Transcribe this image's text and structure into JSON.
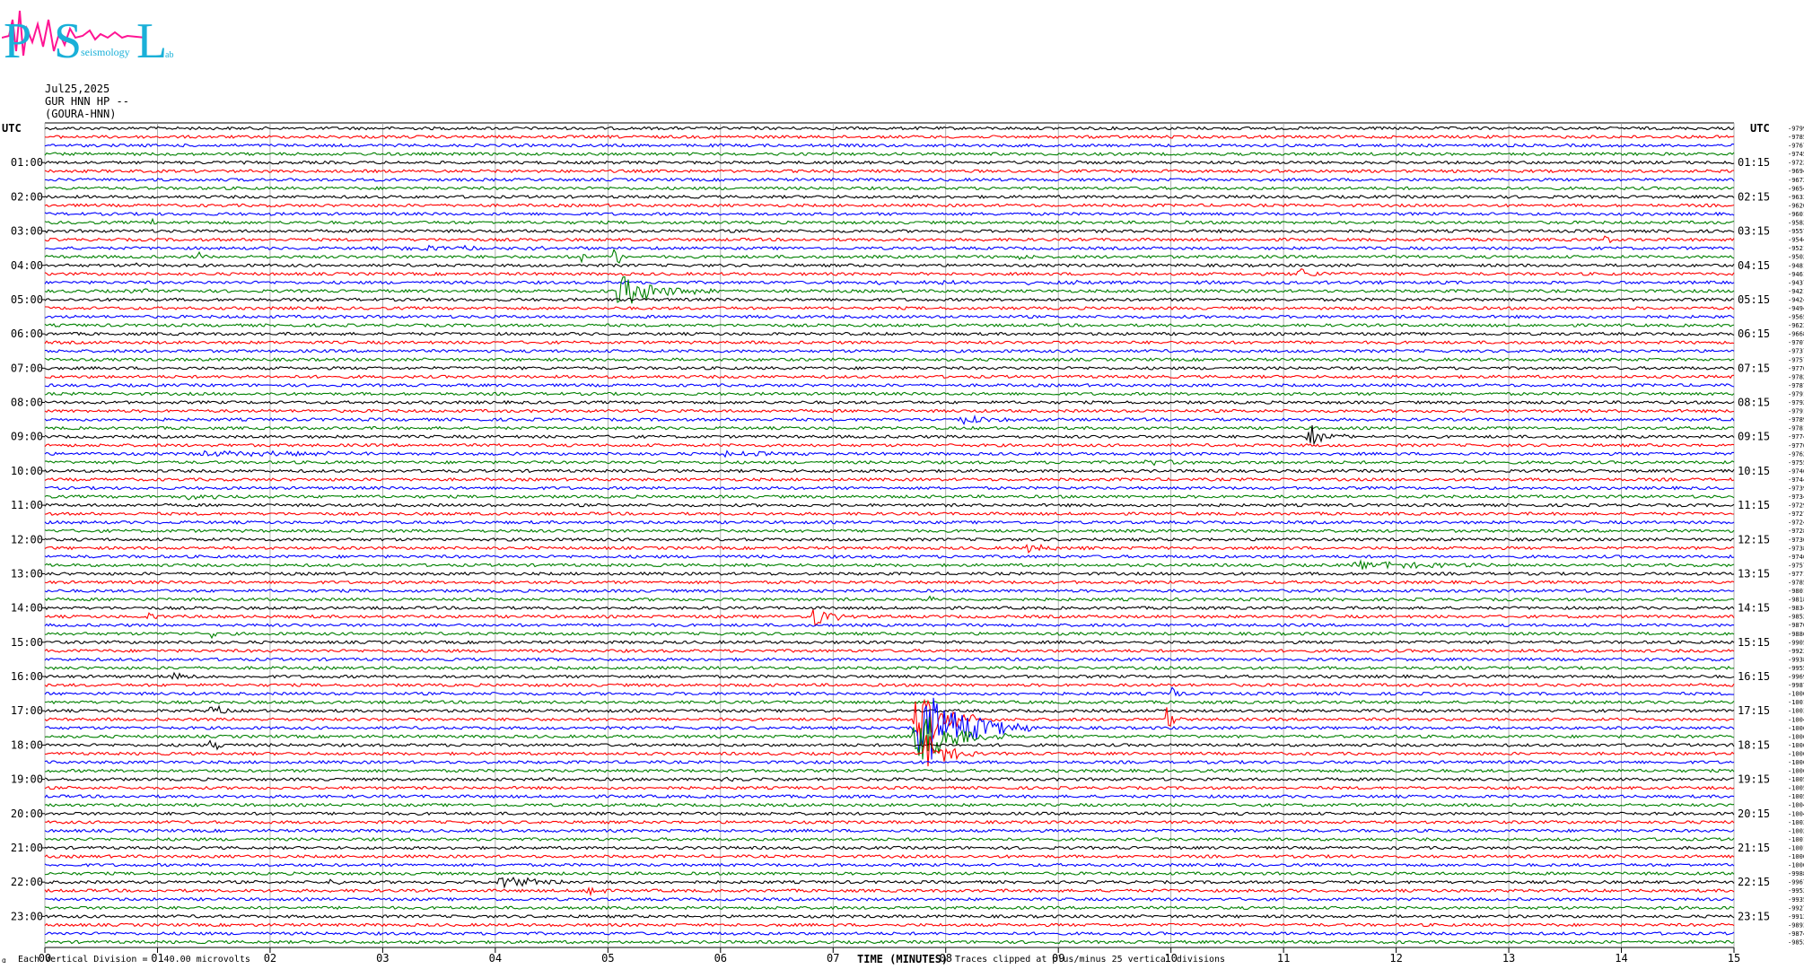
{
  "logo": {
    "letters": [
      "P",
      "S",
      "L"
    ],
    "subtitle": "seismology",
    "subtitle2": "ab"
  },
  "header": {
    "date": "Jul25,2025",
    "channel": "GUR HNN HP --",
    "site": "(GOURA-HNN)",
    "utc_left": "UTC",
    "utc_right": "UTC"
  },
  "footer": {
    "division": "Each Vertical Division =   40.00 microvolts",
    "xlabel": "TIME (MINUTES)",
    "clip": "Traces clipped at plus/minus 25 vertical divisions",
    "mark": "ɑ"
  },
  "colors": {
    "cycle": [
      "#000000",
      "#ff0000",
      "#0000ff",
      "#008000"
    ],
    "grid": "#9a9a9a",
    "logo_pink": "#ff1493",
    "logo_cyan": "#1ab0d8"
  },
  "chart_data": {
    "type": "line",
    "title": "",
    "xlabel": "TIME (MINUTES)",
    "xlim": [
      0,
      15
    ],
    "x_ticks": [
      "00",
      "01",
      "02",
      "03",
      "04",
      "05",
      "06",
      "07",
      "08",
      "09",
      "10",
      "11",
      "12",
      "13",
      "14",
      "15"
    ],
    "trace_minutes": 15,
    "trace_count": 96,
    "color_cycle": [
      "black",
      "red",
      "blue",
      "green"
    ],
    "left_hour_labels": [
      "01:00",
      "02:00",
      "03:00",
      "04:00",
      "05:00",
      "06:00",
      "07:00",
      "08:00",
      "09:00",
      "10:00",
      "11:00",
      "12:00",
      "13:00",
      "14:00",
      "15:00",
      "16:00",
      "17:00",
      "18:00",
      "19:00",
      "20:00",
      "21:00",
      "22:00",
      "23:00"
    ],
    "right_hour_labels": [
      "01:15",
      "02:15",
      "03:15",
      "04:15",
      "05:15",
      "06:15",
      "07:15",
      "08:15",
      "09:15",
      "10:15",
      "11:15",
      "12:15",
      "13:15",
      "14:15",
      "15:15",
      "16:15",
      "17:15",
      "18:15",
      "19:15",
      "20:15",
      "21:15",
      "22:15",
      "23:15"
    ],
    "right_values": [
      "-9799",
      "-9785",
      "-9767",
      "-9745",
      "-9722",
      "-9694",
      "-9672",
      "-9654",
      "-9633",
      "-9620",
      "-9601",
      "-9582",
      "-9557",
      "-9544",
      "-9521",
      "-9502",
      "-9481",
      "-9461",
      "-9437",
      "-9421",
      "-9424",
      "-9494",
      "-9565",
      "-9623",
      "-9668",
      "-9707",
      "-9737",
      "-9757",
      "-9776",
      "-9782",
      "-9787",
      "-9791",
      "-9792",
      "-9791",
      "-9789",
      "-9781",
      "-9774",
      "-9770",
      "-9762",
      "-9755",
      "-9746",
      "-9744",
      "-9739",
      "-9734",
      "-9729",
      "-9727",
      "-9724",
      "-9728",
      "-9730",
      "-9738",
      "-9746",
      "-9757",
      "-9771",
      "-9785",
      "-9801",
      "-9818",
      "-9834",
      "-9852",
      "-9870",
      "-9886",
      "-9905",
      "-9923",
      "-9938",
      "-9955",
      "-9969",
      "-9987",
      "-10003",
      "-10018",
      "-10031",
      "-10047",
      "-10060",
      "-10066",
      "-10068",
      "-10068",
      "-10069",
      "-10063",
      "-10059",
      "-10052",
      "-10051",
      "-10047",
      "-10041",
      "-10034",
      "-10025",
      "-10014",
      "-10011",
      "-10007",
      "-10002",
      "-9988",
      "-9967",
      "-9952",
      "-9935",
      "-9927",
      "-9913",
      "-9893",
      "-9874",
      "-9852"
    ],
    "events": [
      {
        "trace": 11,
        "minute": 0.95,
        "duration": 0.05,
        "amp": 8
      },
      {
        "trace": 16,
        "minute": 0.8,
        "duration": 0.25,
        "amp": 3
      },
      {
        "trace": 19,
        "minute": 0.75,
        "duration": 0.5,
        "amp": 3
      },
      {
        "trace": 14,
        "minute": 3.1,
        "duration": 3.0,
        "amp": 3
      },
      {
        "trace": 15,
        "minute": 1.35,
        "duration": 0.15,
        "amp": 10
      },
      {
        "trace": 15,
        "minute": 4.75,
        "duration": 0.15,
        "amp": 10
      },
      {
        "trace": 15,
        "minute": 5.05,
        "duration": 0.15,
        "amp": 22
      },
      {
        "trace": 19,
        "minute": 5.05,
        "duration": 0.95,
        "amp": 22
      },
      {
        "trace": 15,
        "minute": 8.65,
        "duration": 0.25,
        "amp": 4
      },
      {
        "trace": 13,
        "minute": 13.85,
        "duration": 0.1,
        "amp": 10
      },
      {
        "trace": 17,
        "minute": 11.1,
        "duration": 0.5,
        "amp": 8
      },
      {
        "trace": 18,
        "minute": 7.0,
        "duration": 8.0,
        "amp": 2
      },
      {
        "trace": 34,
        "minute": 8.1,
        "duration": 0.9,
        "amp": 5
      },
      {
        "trace": 36,
        "minute": 11.2,
        "duration": 0.4,
        "amp": 18
      },
      {
        "trace": 38,
        "minute": 1.3,
        "duration": 3.0,
        "amp": 4
      },
      {
        "trace": 38,
        "minute": 6.0,
        "duration": 1.0,
        "amp": 4
      },
      {
        "trace": 39,
        "minute": 9.7,
        "duration": 1.0,
        "amp": 4
      },
      {
        "trace": 43,
        "minute": 1.2,
        "duration": 1.0,
        "amp": 4
      },
      {
        "trace": 49,
        "minute": 8.7,
        "duration": 0.6,
        "amp": 6
      },
      {
        "trace": 51,
        "minute": 11.6,
        "duration": 2.0,
        "amp": 5
      },
      {
        "trace": 55,
        "minute": 7.8,
        "duration": 0.6,
        "amp": 3
      },
      {
        "trace": 57,
        "minute": 6.8,
        "duration": 0.4,
        "amp": 18
      },
      {
        "trace": 57,
        "minute": 0.9,
        "duration": 0.4,
        "amp": 4
      },
      {
        "trace": 59,
        "minute": 1.45,
        "duration": 0.1,
        "amp": 14
      },
      {
        "trace": 64,
        "minute": 1.1,
        "duration": 0.6,
        "amp": 4
      },
      {
        "trace": 66,
        "minute": 10.0,
        "duration": 0.1,
        "amp": 18
      },
      {
        "trace": 68,
        "minute": 1.45,
        "duration": 0.25,
        "amp": 12
      },
      {
        "trace": 69,
        "minute": 7.7,
        "duration": 0.8,
        "amp": 40
      },
      {
        "trace": 69,
        "minute": 9.95,
        "duration": 0.15,
        "amp": 24
      },
      {
        "trace": 70,
        "minute": 7.7,
        "duration": 1.1,
        "amp": 60
      },
      {
        "trace": 71,
        "minute": 7.7,
        "duration": 0.9,
        "amp": 40
      },
      {
        "trace": 72,
        "minute": 1.45,
        "duration": 0.3,
        "amp": 8
      },
      {
        "trace": 73,
        "minute": 7.8,
        "duration": 0.5,
        "amp": 30
      },
      {
        "trace": 76,
        "minute": 5.9,
        "duration": 0.9,
        "amp": 4
      },
      {
        "trace": 88,
        "minute": 2.5,
        "duration": 0.2,
        "amp": 6
      },
      {
        "trace": 88,
        "minute": 4.0,
        "duration": 1.2,
        "amp": 8
      },
      {
        "trace": 89,
        "minute": 4.8,
        "duration": 0.2,
        "amp": 12
      }
    ]
  }
}
